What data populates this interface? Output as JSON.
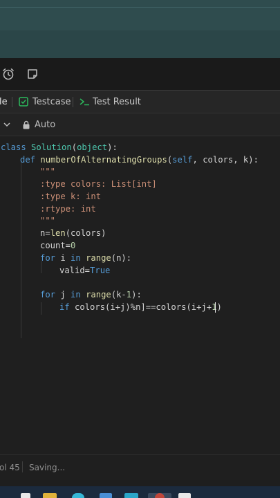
{
  "toolbar": {
    "icons": [
      "alarm-clock-icon",
      "note-icon"
    ]
  },
  "tabs": {
    "partial_label": "le",
    "testcase_label": "Testcase",
    "test_result_label": "Test Result",
    "testcase_check_color": "#2cbb5d"
  },
  "subbar": {
    "mode_label": "Auto"
  },
  "code": {
    "l1": {
      "kw": "class",
      "name": "Solution",
      "p1": "(",
      "base": "object",
      "p2": "):"
    },
    "l2": {
      "kw": "def",
      "name": "numberOfAlternatingGroups",
      "p1": "(",
      "self": "self",
      "c1": ", ",
      "a1": "colors",
      "c2": ", ",
      "a2": "k",
      "p2": "):"
    },
    "l3": "\"\"\"",
    "l4": ":type colors: List[int]",
    "l5": ":type k: int",
    "l6": ":rtype: int",
    "l7": "\"\"\"",
    "l8": {
      "a": "n=",
      "b": "len",
      "c": "(colors)"
    },
    "l9": {
      "a": "count=",
      "b": "0"
    },
    "l10": {
      "kw1": "for",
      "a": " i ",
      "kw2": "in",
      "sp": " ",
      "b": "range",
      "c": "(n):"
    },
    "l11": {
      "a": "valid=",
      "b": "True"
    },
    "l13": {
      "kw1": "for",
      "a": " j ",
      "kw2": "in",
      "sp": " ",
      "b": "range",
      "c": "(k-",
      "d": "1",
      "e": "):"
    },
    "l14": {
      "kw": "if",
      "a": " colors(i+j)%n]==colors(i+j+",
      "b": "1",
      "c": ")"
    }
  },
  "status": {
    "position": "ol 45",
    "state": "Saving..."
  }
}
